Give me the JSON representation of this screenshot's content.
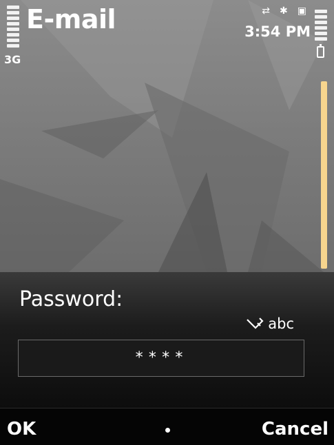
{
  "app": {
    "title": "E-mail"
  },
  "status": {
    "network": "3G",
    "time": "3:54 PM"
  },
  "dialog": {
    "label": "Password:",
    "input_mode": "abc",
    "password_value": "****"
  },
  "softkeys": {
    "left": "OK",
    "right": "Cancel"
  },
  "icons": {
    "signal": "signal-strength-icon",
    "battery_level": "battery-level-icon",
    "battery": "battery-icon",
    "data": "data-transfer-icon",
    "bluetooth": "bluetooth-icon",
    "sim": "sim-card-icon",
    "pencil": "pencil-input-mode-icon",
    "center": "center-softkey-dot-icon"
  },
  "colors": {
    "scrollbar": "#f7d58e",
    "text": "#ffffff",
    "dialog_bg": "#1c1c1c"
  }
}
